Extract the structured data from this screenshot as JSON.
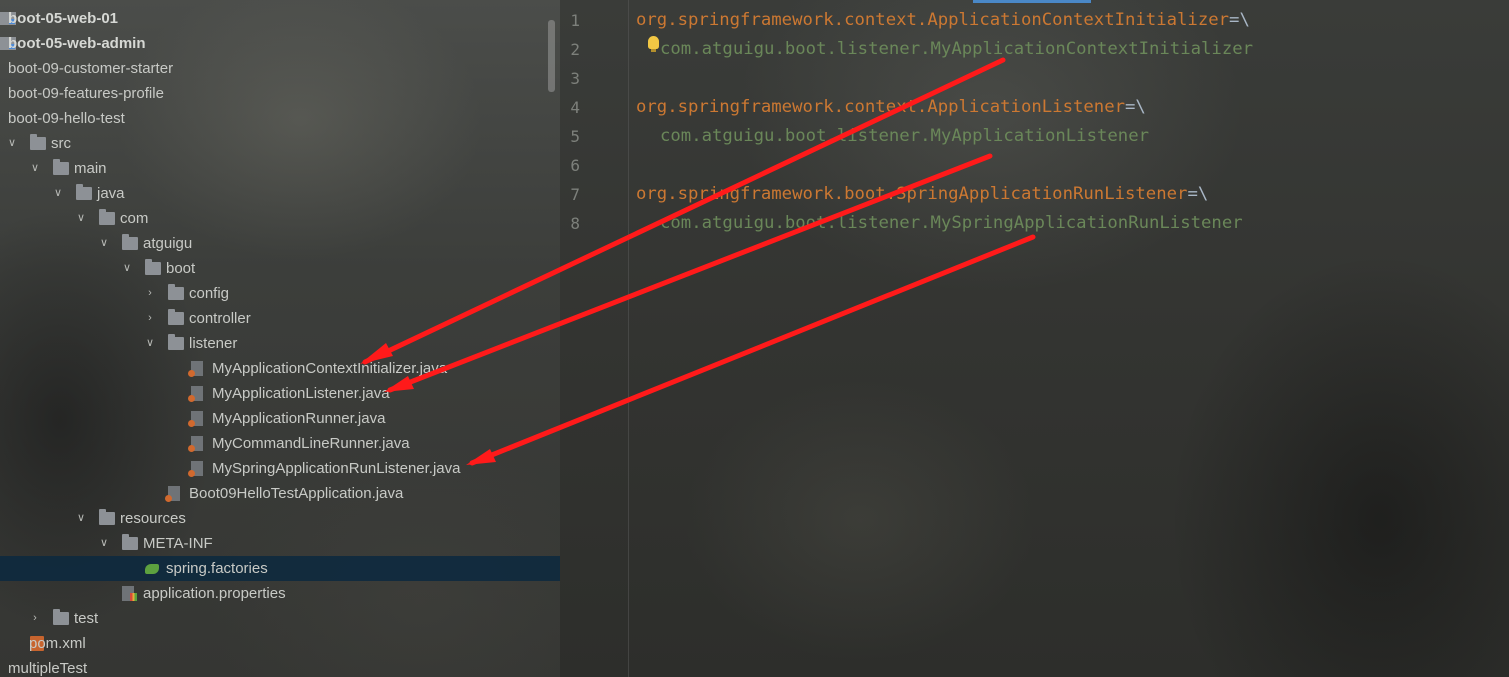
{
  "project_tree": {
    "items": [
      {
        "label": "boot-05-web-01",
        "icon": "module-folder-icon",
        "arrow": "",
        "bold": true
      },
      {
        "label": "boot-05-web-admin",
        "icon": "module-folder-icon",
        "arrow": "",
        "bold": true
      },
      {
        "label": "boot-09-customer-starter",
        "icon": "",
        "arrow": ""
      },
      {
        "label": "boot-09-features-profile",
        "icon": "",
        "arrow": ""
      },
      {
        "label": "boot-09-hello-test",
        "icon": "",
        "arrow": ""
      },
      {
        "label": "src",
        "icon": "folder-icon",
        "arrow": "down"
      },
      {
        "label": "main",
        "icon": "folder-icon",
        "arrow": "down"
      },
      {
        "label": "java",
        "icon": "folder-icon",
        "arrow": "down"
      },
      {
        "label": "com",
        "icon": "folder-icon",
        "arrow": "down"
      },
      {
        "label": "atguigu",
        "icon": "folder-icon",
        "arrow": "down"
      },
      {
        "label": "boot",
        "icon": "folder-icon",
        "arrow": "down"
      },
      {
        "label": "config",
        "icon": "folder-icon",
        "arrow": "right"
      },
      {
        "label": "controller",
        "icon": "folder-icon",
        "arrow": "right"
      },
      {
        "label": "listener",
        "icon": "folder-icon",
        "arrow": "down"
      },
      {
        "label": "MyApplicationContextInitializer.java",
        "icon": "java-file-icon",
        "arrow": ""
      },
      {
        "label": "MyApplicationListener.java",
        "icon": "java-file-icon",
        "arrow": ""
      },
      {
        "label": "MyApplicationRunner.java",
        "icon": "java-file-icon",
        "arrow": ""
      },
      {
        "label": "MyCommandLineRunner.java",
        "icon": "java-file-icon",
        "arrow": ""
      },
      {
        "label": "MySpringApplicationRunListener.java",
        "icon": "java-file-icon",
        "arrow": ""
      },
      {
        "label": "Boot09HelloTestApplication.java",
        "icon": "java-file-icon",
        "arrow": ""
      },
      {
        "label": "resources",
        "icon": "folder-icon",
        "arrow": "down"
      },
      {
        "label": "META-INF",
        "icon": "folder-icon",
        "arrow": "down"
      },
      {
        "label": "spring.factories",
        "icon": "spring-factories-icon",
        "arrow": "",
        "selected": true
      },
      {
        "label": "application.properties",
        "icon": "properties-file-icon",
        "arrow": ""
      },
      {
        "label": "test",
        "icon": "folder-icon",
        "arrow": "right"
      },
      {
        "label": "pom.xml",
        "icon": "xml-file-icon",
        "arrow": ""
      },
      {
        "label": "multipleTest",
        "icon": "",
        "arrow": ""
      }
    ]
  },
  "editor": {
    "file": "spring.factories",
    "lines": [
      {
        "number": "1",
        "key": "org.springframework.context.ApplicationContextInitializer",
        "sep": "=\\",
        "value": ""
      },
      {
        "number": "2",
        "key": "",
        "sep": "",
        "value": "com.atguigu.boot.listener.MyApplicationContextInitializer"
      },
      {
        "number": "3",
        "key": "",
        "sep": "",
        "value": ""
      },
      {
        "number": "4",
        "key": "org.springframework.context.ApplicationListener",
        "sep": "=\\",
        "value": ""
      },
      {
        "number": "5",
        "key": "",
        "sep": "",
        "value": "com.atguigu.boot.listener.MyApplicationListener"
      },
      {
        "number": "6",
        "key": "",
        "sep": "",
        "value": ""
      },
      {
        "number": "7",
        "key": "org.springframework.boot.SpringApplicationRunListener",
        "sep": "=\\",
        "value": ""
      },
      {
        "number": "8",
        "key": "",
        "sep": "",
        "value": "com.atguigu.boot.listener.MySpringApplicationRunListener"
      }
    ]
  },
  "colors": {
    "key": "#cc7832",
    "value": "#6a8759",
    "selection": "#0d293f",
    "annotation_arrow": "#ff1a1a"
  }
}
